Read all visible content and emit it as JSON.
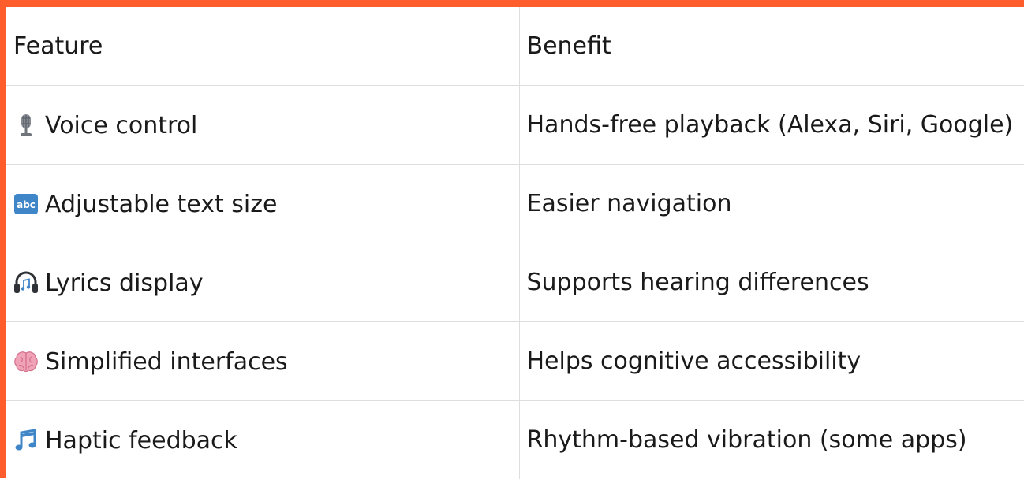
{
  "colors": {
    "frame": "#ff5e2c",
    "grid": "#dedede",
    "text": "#1a1a1a"
  },
  "table": {
    "headers": [
      "Feature",
      "Benefit"
    ],
    "rows": [
      {
        "icon": "microphone-icon",
        "feature": "Voice control",
        "benefit": "Hands-free playback (Alexa, Siri, Google)"
      },
      {
        "icon": "abc-input-icon",
        "feature": "Adjustable text size",
        "benefit": "Easier navigation"
      },
      {
        "icon": "headphones-icon",
        "feature": "Lyrics display",
        "benefit": "Supports hearing differences"
      },
      {
        "icon": "brain-icon",
        "feature": "Simplified interfaces",
        "benefit": "Helps cognitive accessibility"
      },
      {
        "icon": "musical-notes-icon",
        "feature": "Haptic feedback",
        "benefit": "Rhythm-based vibration (some apps)"
      }
    ]
  }
}
